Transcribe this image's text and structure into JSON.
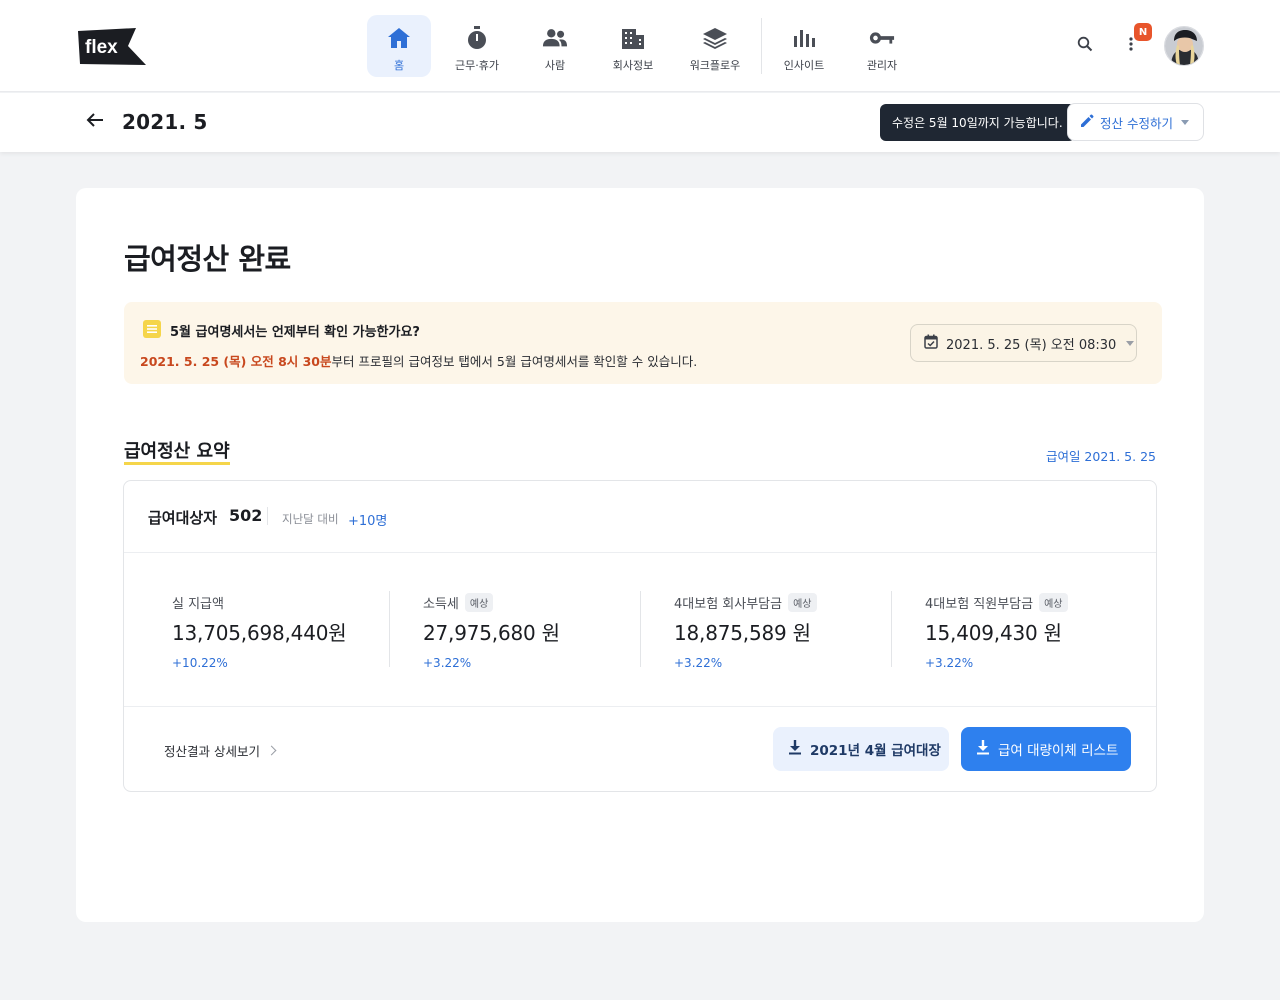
{
  "app": {
    "logo_text": "flex"
  },
  "nav": {
    "items": [
      {
        "label": "홈",
        "icon": "home-icon",
        "active": true
      },
      {
        "label": "근무·휴가",
        "icon": "stopwatch-icon"
      },
      {
        "label": "사람",
        "icon": "people-icon"
      },
      {
        "label": "회사정보",
        "icon": "building-icon"
      },
      {
        "label": "워크플로우",
        "icon": "layers-icon"
      },
      {
        "label": "인사이트",
        "icon": "bar-chart-icon"
      },
      {
        "label": "관리자",
        "icon": "key-icon"
      }
    ],
    "notification_badge": "N"
  },
  "subheader": {
    "period": "2021. 5",
    "tooltip": "수정은 5월 10일까지 가능합니다.",
    "edit_button": "정산 수정하기"
  },
  "main": {
    "title": "급여정산 완료",
    "notice": {
      "question": "5월 급여명세서는 언제부터 확인 가능한가요?",
      "answer_highlight": "2021. 5. 25 (목) 오전 8시 30분",
      "answer_rest": "부터 프로필의 급여정보 탭에서 5월 급여명세서를 확인할 수 있습니다.",
      "date_select": "2021. 5. 25 (목) 오전 08:30"
    },
    "summary": {
      "title": "급여정산 요약",
      "payday": "급여일 2021. 5. 25",
      "target_label": "급여대상자",
      "target_count": "502",
      "compare_label": "지난달 대비",
      "compare_delta": "+10명",
      "metrics": [
        {
          "label": "실 지급액",
          "tag": "",
          "value": "13,705,698,440원",
          "pct": "+10.22%"
        },
        {
          "label": "소득세",
          "tag": "예상",
          "value": "27,975,680 원",
          "pct": "+3.22%"
        },
        {
          "label": "4대보험 회사부담금",
          "tag": "예상",
          "value": "18,875,589 원",
          "pct": "+3.22%"
        },
        {
          "label": "4대보험 직원부담금",
          "tag": "예상",
          "value": "15,409,430 원",
          "pct": "+3.22%"
        }
      ],
      "detail_link": "정산결과 상세보기",
      "download_ledger": "2021년 4월 급여대장",
      "download_transfer": "급여 대량이체 리스트"
    }
  },
  "colors": {
    "accent": "#2e6fd6",
    "primary_button": "#2e80ee",
    "notice_bg": "#fdf6e9",
    "highlight": "#c8481e",
    "badge": "#e8552b"
  }
}
